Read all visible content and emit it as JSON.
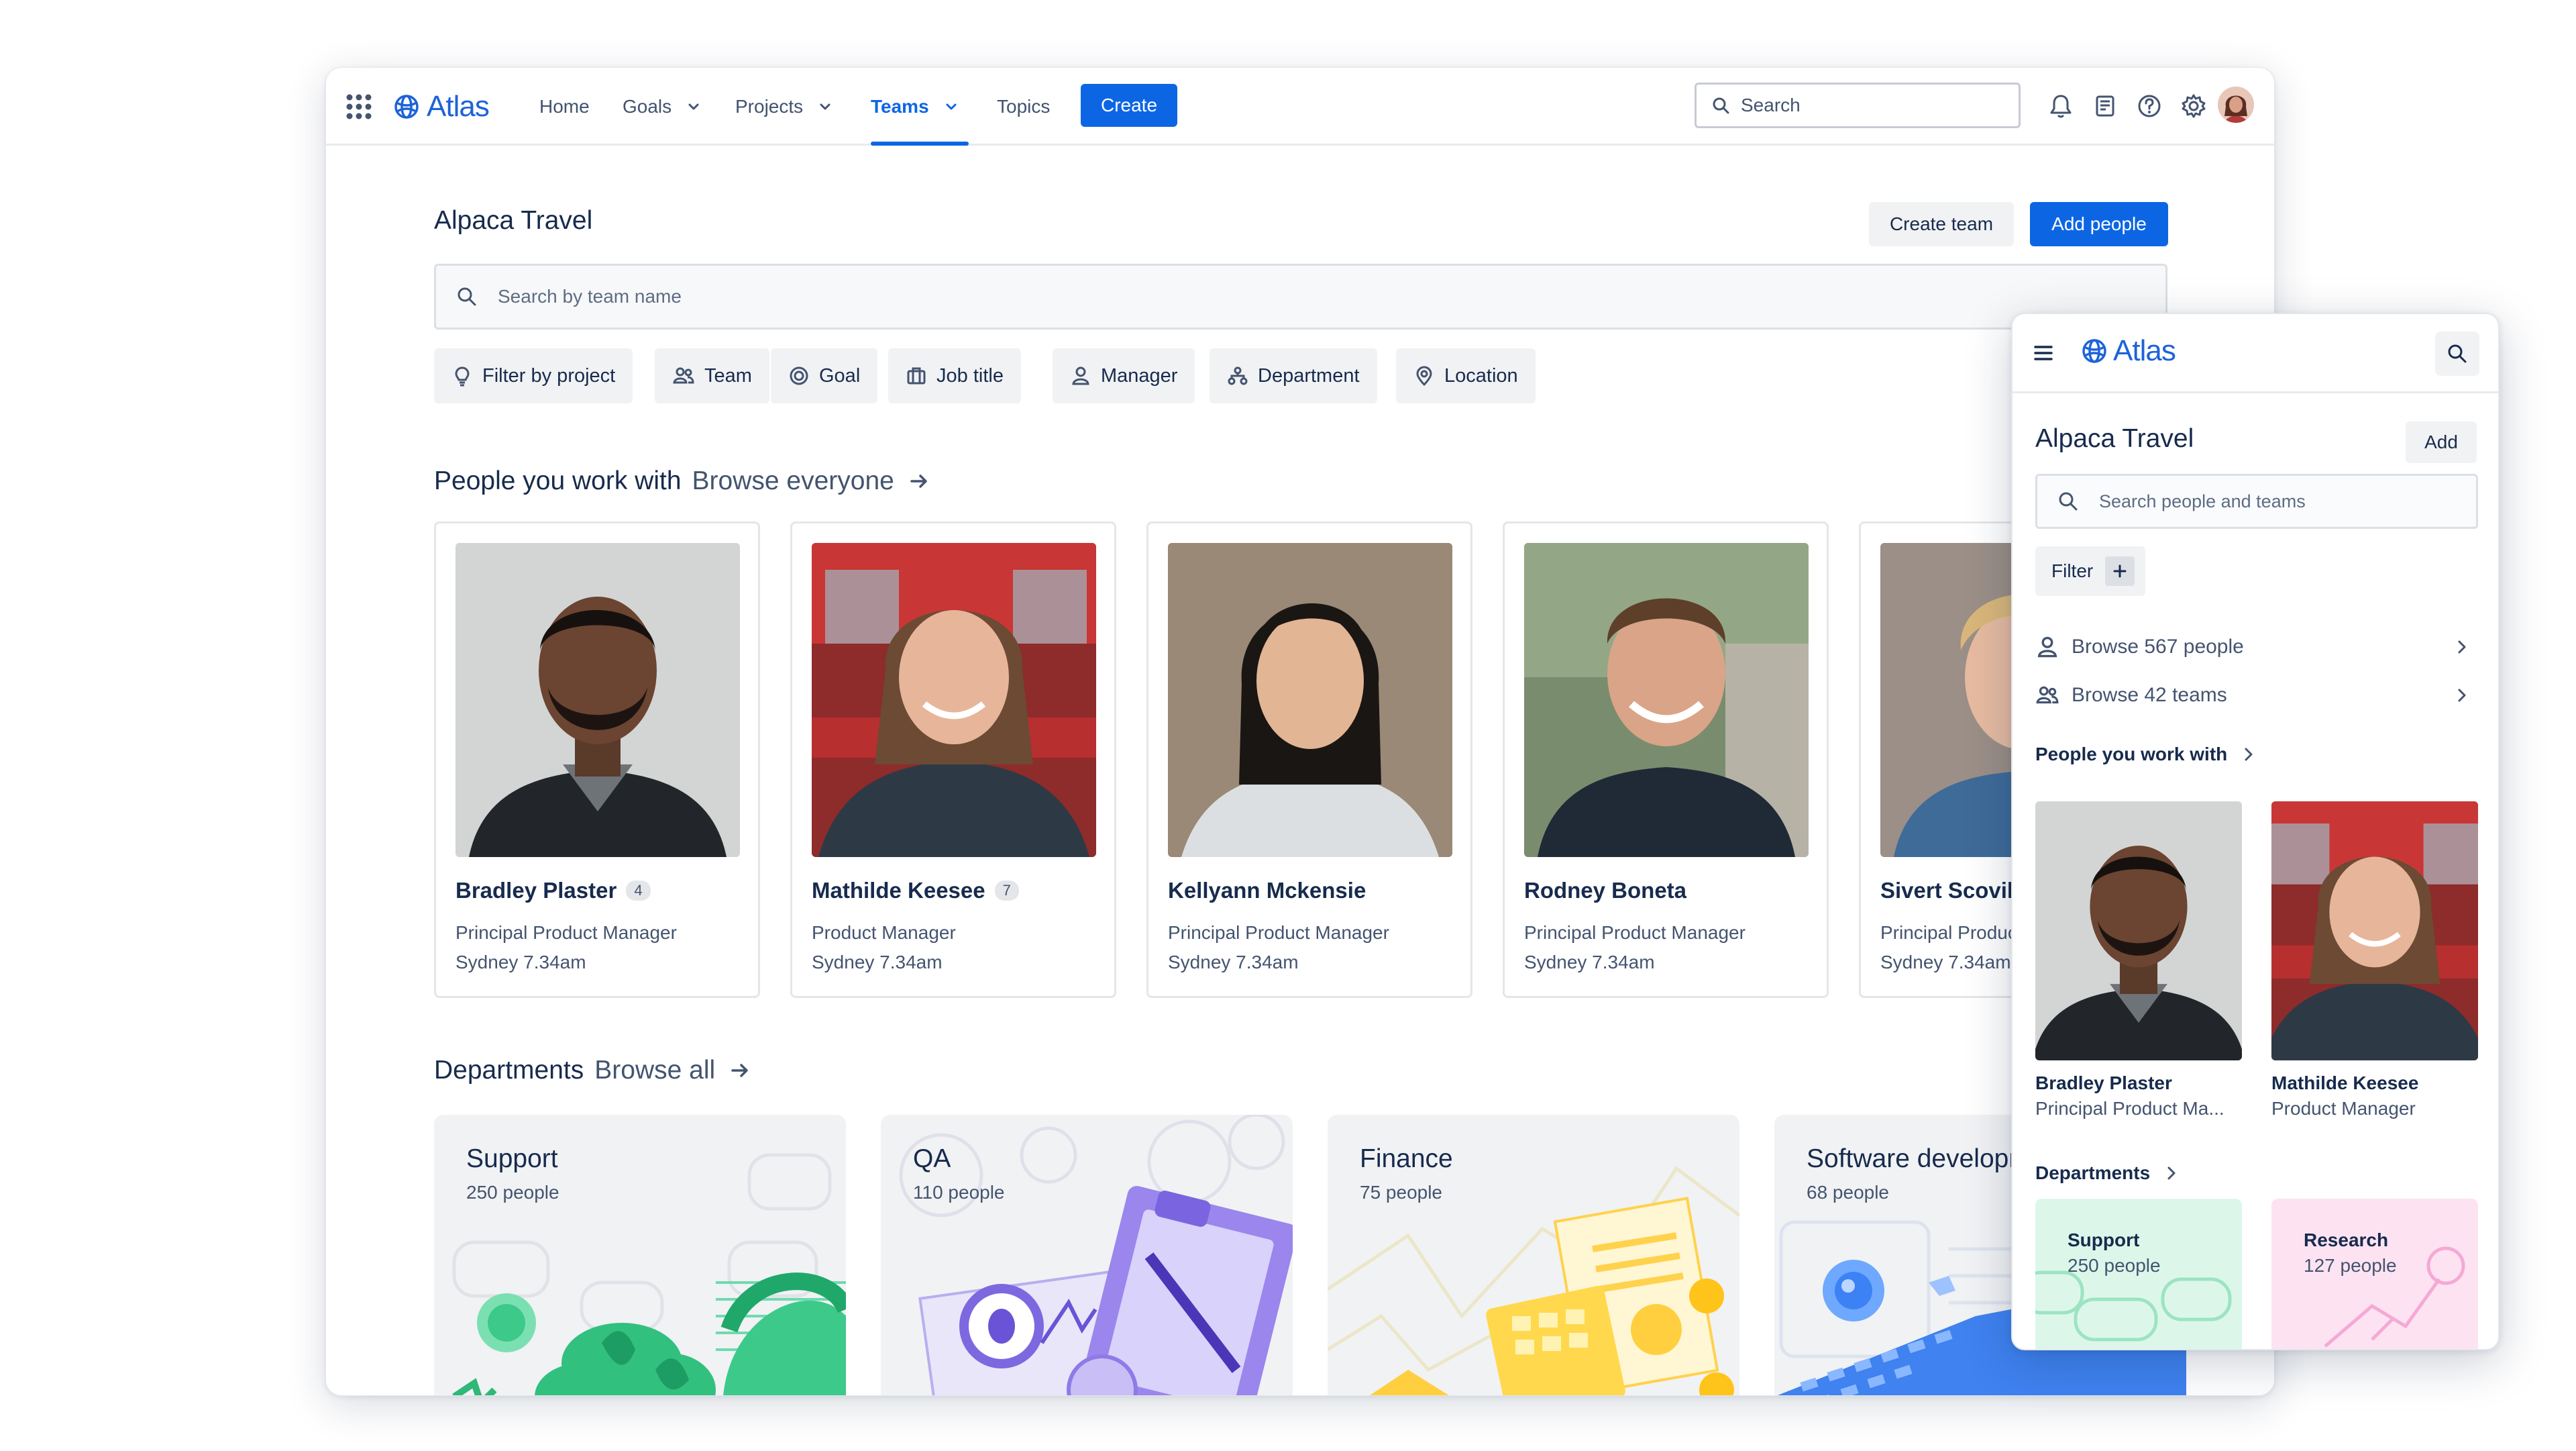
{
  "app": {
    "name": "Atlas"
  },
  "nav": {
    "home": "Home",
    "goals": "Goals",
    "projects": "Projects",
    "teams": "Teams",
    "topics": "Topics",
    "create": "Create",
    "search_placeholder": "Search",
    "icons": [
      "bell-icon",
      "page-icon",
      "help-icon",
      "gear-icon"
    ]
  },
  "page": {
    "title": "Alpaca Travel",
    "create_team": "Create team",
    "add_people": "Add people",
    "search_placeholder": "Search by team name",
    "filters": [
      "Filter by project",
      "Team",
      "Goal",
      "Job title",
      "Manager",
      "Department",
      "Location"
    ]
  },
  "people_section": {
    "title": "People you work with",
    "link": "Browse everyone"
  },
  "people": [
    {
      "name": "Bradley Plaster",
      "badge": "4",
      "role": "Principal Product Manager",
      "location": "Sydney 7.34am"
    },
    {
      "name": "Mathilde Keesee",
      "badge": "7",
      "role": "Product Manager",
      "location": "Sydney 7.34am"
    },
    {
      "name": "Kellyann Mckensie",
      "badge": "",
      "role": "Principal Product Manager",
      "location": "Sydney 7.34am"
    },
    {
      "name": "Rodney Boneta",
      "badge": "",
      "role": "Principal Product Manager",
      "location": "Sydney 7.34am"
    },
    {
      "name": "Sivert Scoville",
      "badge": "",
      "role": "Principal Product Manager",
      "location": "Sydney 7.34am"
    }
  ],
  "departments_section": {
    "title": "Departments",
    "link": "Browse all"
  },
  "departments": [
    {
      "name": "Support",
      "count": "250 people"
    },
    {
      "name": "QA",
      "count": "110 people"
    },
    {
      "name": "Finance",
      "count": "75 people"
    },
    {
      "name": "Software development",
      "count": "68 people"
    }
  ],
  "mobile": {
    "title": "Alpaca Travel",
    "add": "Add",
    "search_placeholder": "Search people and teams",
    "filter": "Filter",
    "browse_people": "Browse 567 people",
    "browse_teams": "Browse 42 teams",
    "people_title": "People you work with",
    "people": [
      {
        "name": "Bradley Plaster",
        "role": "Principal Product Ma..."
      },
      {
        "name": "Mathilde Keesee",
        "role": "Product Manager"
      }
    ],
    "departments_title": "Departments",
    "departments": [
      {
        "name": "Support",
        "count": "250 people"
      },
      {
        "name": "Research",
        "count": "127 people"
      }
    ]
  },
  "colors": {
    "primary": "#0c66e4",
    "text": "#172b4d",
    "subtle": "#44546f",
    "chip_bg": "#f1f2f4"
  }
}
